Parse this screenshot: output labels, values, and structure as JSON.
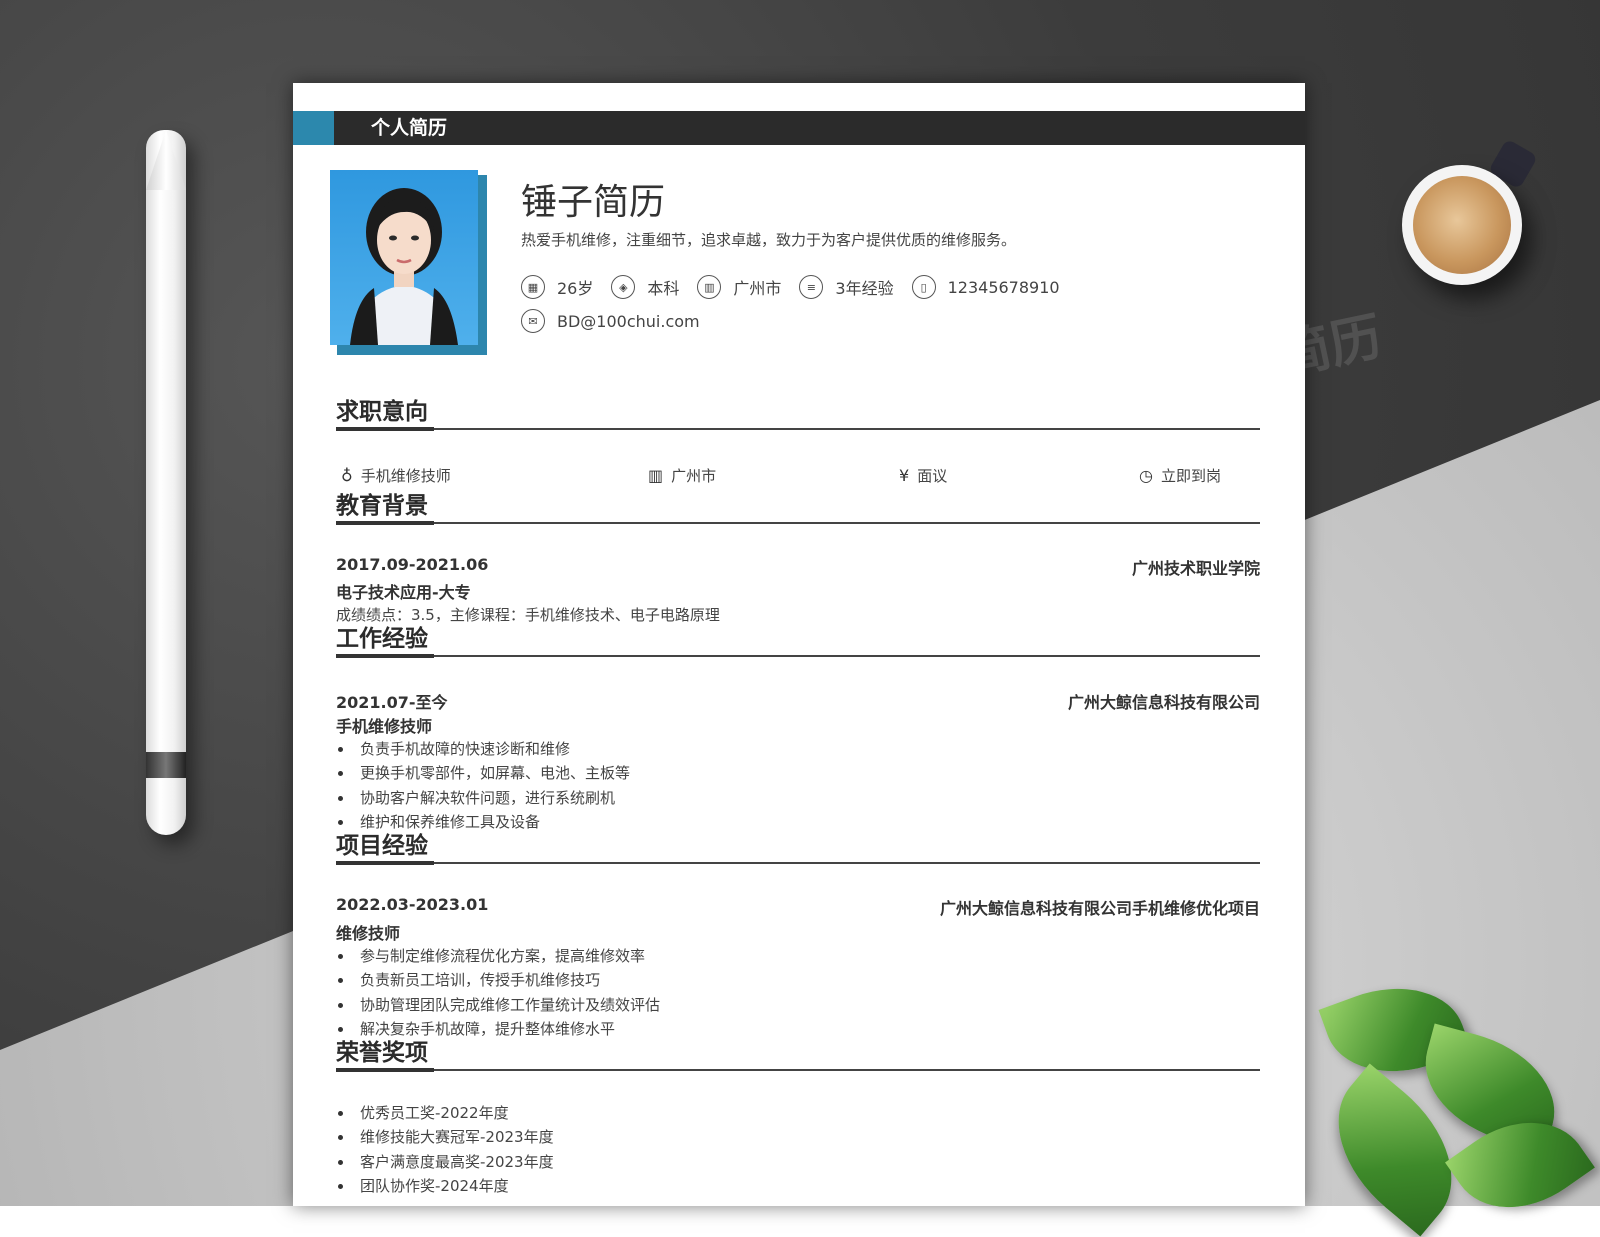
{
  "header": {
    "title": "个人简历"
  },
  "profile": {
    "name": "锤子简历",
    "motto": "热爱手机维修，注重细节，追求卓越，致力于为客户提供优质的维修服务。",
    "age": "26岁",
    "degree": "本科",
    "city": "广州市",
    "experience": "3年经验",
    "phone": "12345678910",
    "email": "BD@100chui.com"
  },
  "intent": {
    "title": "求职意向",
    "position": "手机维修技师",
    "city": "广州市",
    "salary": "面议",
    "availability": "立即到岗"
  },
  "education": {
    "title": "教育背景",
    "period": "2017.09-2021.06",
    "school": "广州技术职业学院",
    "major": "电子技术应用-大专",
    "detail": "成绩绩点：3.5，主修课程：手机维修技术、电子电路原理"
  },
  "work": {
    "title": "工作经验",
    "period": "2021.07-至今",
    "company": "广州大鲸信息科技有限公司",
    "role": "手机维修技师",
    "items": [
      "负责手机故障的快速诊断和维修",
      "更换手机零部件，如屏幕、电池、主板等",
      "协助客户解决软件问题，进行系统刷机",
      "维护和保养维修工具及设备"
    ]
  },
  "project": {
    "title": "项目经验",
    "period": "2022.03-2023.01",
    "name": "广州大鲸信息科技有限公司手机维修优化项目",
    "role": "维修技师",
    "items": [
      "参与制定维修流程优化方案，提高维修效率",
      "负责新员工培训，传授手机维修技巧",
      "协助管理团队完成维修工作量统计及绩效评估",
      "解决复杂手机故障，提升整体维修水平"
    ]
  },
  "honors": {
    "title": "荣誉奖项",
    "items": [
      "优秀员工奖-2022年度",
      "维修技能大赛冠军-2023年度",
      "客户满意度最高奖-2023年度",
      "团队协作奖-2024年度"
    ]
  },
  "stamp": {
    "text": "简历"
  },
  "icons": {
    "age": "calendar-icon",
    "degree": "graduation-cap-icon",
    "city": "building-icon",
    "experience": "document-icon",
    "phone": "phone-icon",
    "email": "envelope-icon",
    "position": "tie-icon",
    "intent_city": "building-icon",
    "salary": "yen-icon",
    "availability": "clock-icon"
  },
  "colors": {
    "accent": "#2c88ad",
    "bar": "#2b2b2b"
  }
}
